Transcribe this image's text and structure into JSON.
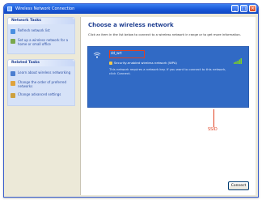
{
  "window": {
    "title": "Wireless Network Connection"
  },
  "sidebar": {
    "network_tasks": {
      "header": "Network Tasks",
      "items": [
        {
          "label": "Refresh network list",
          "icon": "refresh-icon"
        },
        {
          "label": "Set up a wireless network for a home or small office",
          "icon": "setup-icon"
        }
      ]
    },
    "related_tasks": {
      "header": "Related Tasks",
      "items": [
        {
          "label": "Learn about wireless networking",
          "icon": "learn-icon"
        },
        {
          "label": "Change the order of preferred networks",
          "icon": "order-icon"
        },
        {
          "label": "Change advanced settings",
          "icon": "advanced-icon"
        }
      ]
    }
  },
  "main": {
    "title": "Choose a wireless network",
    "description": "Click an item in the list below to connect to a wireless network in range or to get more information.",
    "networks": [
      {
        "name": "dd_wrt",
        "security": "Security-enabled wireless network (WPA)",
        "description": "This network requires a network key. If you want to connect to this network, click Connect."
      }
    ],
    "annotation_label": "SSID",
    "connect_label": "Connect"
  },
  "colors": {
    "selection": "#316ac5",
    "accent": "#1f3f91",
    "annotation": "#e04020"
  }
}
